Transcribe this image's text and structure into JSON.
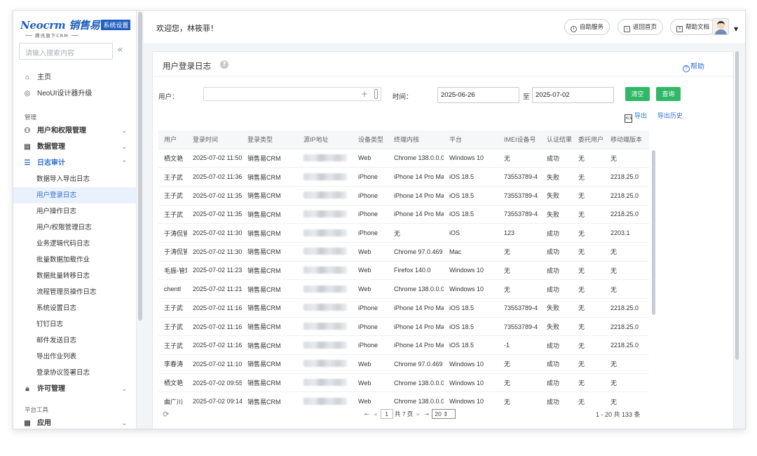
{
  "brand": {
    "name": "Neocrm 销售易",
    "badge": "系统设置",
    "tagline": "腾讯旗下CRM"
  },
  "sidebar": {
    "search_placeholder": "请输入搜索内容",
    "home": "主页",
    "neoui": "NeoUI设计器升级",
    "section_manage": "管理",
    "user_perm": "用户和权限管理",
    "data_mgmt": "数据管理",
    "log_audit": "日志审计",
    "sub_items": [
      "数据导入导出日志",
      "用户登录日志",
      "用户操作日志",
      "用户/权限管理日志",
      "业务逻辑代码日志",
      "批量数据加载作业",
      "数据批量转移日志",
      "流程管理员操作日志",
      "系统设置日志",
      "钉钉日志",
      "邮件发送日志",
      "导出作业列表",
      "登录协议签署日志"
    ],
    "license": "许可管理",
    "section_tools": "平台工具",
    "apps": "应用"
  },
  "header": {
    "welcome": "欢迎您，林筱菲！",
    "self_service": "自助服务",
    "back_home": "返回首页",
    "help_docs": "帮助文档"
  },
  "page": {
    "title": "用户登录日志",
    "help": "帮助",
    "user_label": "用户：",
    "time_label": "时间：",
    "date_from": "2025-06-26",
    "date_sep": "至",
    "date_to": "2025-07-02",
    "clear_btn": "清空",
    "query_btn": "查询",
    "export": "导出",
    "export_history": "导出历史"
  },
  "table": {
    "headers": [
      "用户",
      "登录时间",
      "登录类型",
      "源IP地址",
      "设备类型",
      "终端内核",
      "平台",
      "IMEI设备号",
      "认证结果",
      "委托用户",
      "移动端版本"
    ],
    "rows": [
      [
        "栖文艳",
        "2025-07-02 11:50",
        "销售易CRM",
        "Web",
        "Chrome 138.0.0.0",
        "Windows 10",
        "无",
        "成功",
        "无",
        "无"
      ],
      [
        "王子武",
        "2025-07-02 11:36",
        "销售易CRM",
        "iPhone",
        "iPhone 14 Pro Max",
        "iOS 18.5",
        "73553789-4",
        "失败",
        "无",
        "2218.25.0"
      ],
      [
        "王子武",
        "2025-07-02 11:35",
        "销售易CRM",
        "iPhone",
        "iPhone 14 Pro Max",
        "iOS 18.5",
        "73553789-4",
        "失败",
        "无",
        "2218.25.0"
      ],
      [
        "王子武",
        "2025-07-02 11:35",
        "销售易CRM",
        "iPhone",
        "iPhone 14 Pro Max",
        "iOS 18.5",
        "73553789-4",
        "失败",
        "无",
        "2218.25.0"
      ],
      [
        "于涛侃管",
        "2025-07-02 11:30",
        "销售易CRM",
        "iPhone",
        "无",
        "iOS",
        "123",
        "成功",
        "无",
        "2203.1"
      ],
      [
        "于涛侃管",
        "2025-07-02 11:30",
        "销售易CRM",
        "Web",
        "Chrome 97.0.469",
        "Mac",
        "无",
        "成功",
        "无",
        "无"
      ],
      [
        "毛振-管理",
        "2025-07-02 11:23",
        "销售易CRM",
        "Web",
        "Firefox 140.0",
        "Windows 10",
        "无",
        "成功",
        "无",
        "无"
      ],
      [
        "chentl",
        "2025-07-02 11:21",
        "销售易CRM",
        "Web",
        "Chrome 138.0.0.0",
        "Windows 10",
        "无",
        "成功",
        "无",
        "无"
      ],
      [
        "王子武",
        "2025-07-02 11:16",
        "销售易CRM",
        "iPhone",
        "iPhone 14 Pro Max",
        "iOS 18.5",
        "73553789-4",
        "失败",
        "无",
        "2218.25.0"
      ],
      [
        "王子武",
        "2025-07-02 11:16",
        "销售易CRM",
        "iPhone",
        "iPhone 14 Pro Max",
        "iOS 18.5",
        "73553789-4",
        "失败",
        "无",
        "2218.25.0"
      ],
      [
        "王子武",
        "2025-07-02 11:16",
        "销售易CRM",
        "iPhone",
        "iPhone 14 Pro Max",
        "iOS 18.5",
        "-1",
        "成功",
        "无",
        "2218.25.0"
      ],
      [
        "李春涛",
        "2025-07-02 11:10",
        "销售易CRM",
        "Web",
        "Chrome 97.0.469",
        "Windows 10",
        "无",
        "成功",
        "无",
        "无"
      ],
      [
        "栖文艳",
        "2025-07-02 09:55",
        "销售易CRM",
        "Web",
        "Chrome 138.0.0.0",
        "Windows 10",
        "无",
        "成功",
        "无",
        "无"
      ],
      [
        "曲广川",
        "2025-07-02 09:14",
        "销售易CRM",
        "Web",
        "Chrome 138.0.0.0",
        "Windows 10",
        "无",
        "成功",
        "无",
        "无"
      ]
    ]
  },
  "pager": {
    "page": "1",
    "total_pages": "共 7 页",
    "page_size": "20",
    "info": "1 - 20  共 133 条"
  }
}
